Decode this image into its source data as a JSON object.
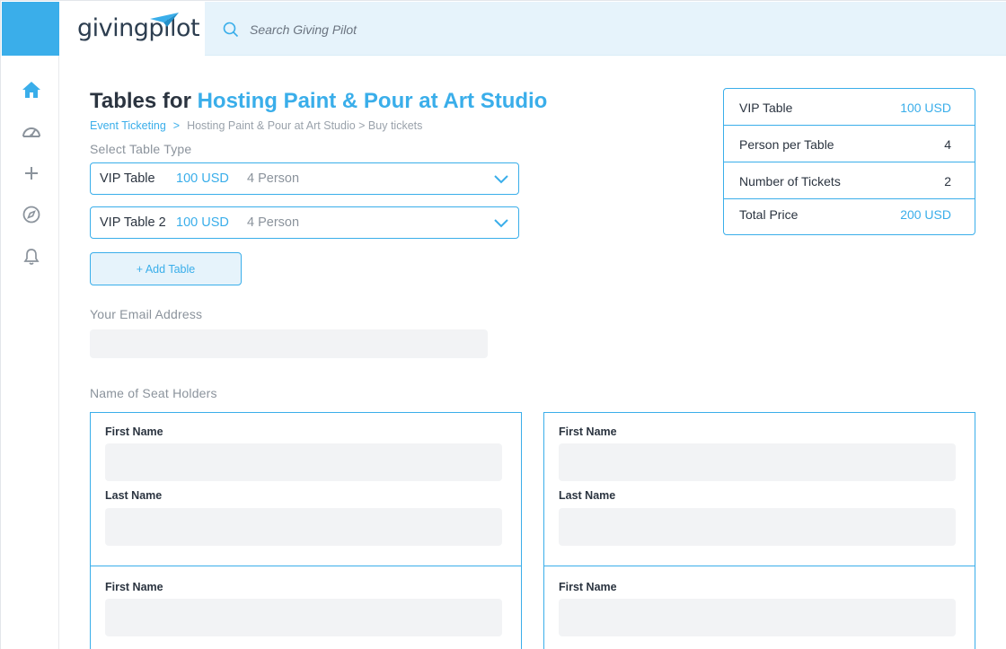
{
  "brand": {
    "logo_text": "givingpilot",
    "accent": "#3aaeea"
  },
  "search": {
    "placeholder": "Search Giving Pilot"
  },
  "nav": [
    "home-icon",
    "dashboard-icon",
    "plus-icon",
    "compass-icon",
    "bell-icon"
  ],
  "page": {
    "title_prefix": "Tables for ",
    "title_event": "Hosting Paint & Pour at Art Studio"
  },
  "breadcrumb": {
    "root": "Event Ticketing",
    "separator": ">",
    "rest": "Hosting Paint & Pour at Art Studio > Buy tickets"
  },
  "table_type": {
    "label": "Select Table Type",
    "options": [
      {
        "name": "VIP Table",
        "price": "100 USD",
        "persons": "4 Person"
      },
      {
        "name": "VIP Table 2",
        "price": "100 USD",
        "persons": "4 Person"
      }
    ],
    "add_label": "+ Add Table"
  },
  "email": {
    "label": "Your Email Address",
    "value": ""
  },
  "seat_holders": {
    "label": "Name of Seat Holders",
    "first_label": "First Name",
    "last_label": "Last Name"
  },
  "summary": [
    {
      "key": "VIP Table",
      "value": "100 USD"
    },
    {
      "key": "Person per Table",
      "value": "4"
    },
    {
      "key": "Number of Tickets",
      "value": "2"
    },
    {
      "key": "Total Price",
      "value": "200 USD"
    }
  ]
}
